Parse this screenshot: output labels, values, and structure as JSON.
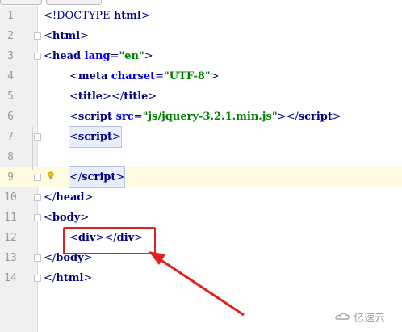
{
  "editor": {
    "lines": [
      {
        "n": "1",
        "tokens": [
          [
            "t",
            "<!DOCTYPE "
          ],
          [
            "b",
            "html"
          ],
          [
            "t",
            ">"
          ]
        ]
      },
      {
        "n": "2",
        "tokens": [
          [
            "t",
            "<"
          ],
          [
            "b",
            "html"
          ],
          [
            "t",
            ">"
          ]
        ]
      },
      {
        "n": "3",
        "tokens": [
          [
            "t",
            "<"
          ],
          [
            "b",
            "head "
          ],
          [
            "attr",
            "lang"
          ],
          [
            "t",
            "="
          ],
          [
            "val",
            "\"en\""
          ],
          [
            "t",
            ">"
          ]
        ]
      },
      {
        "n": "4",
        "tokens": [
          [
            "t",
            "<"
          ],
          [
            "b",
            "meta "
          ],
          [
            "attr",
            "charset"
          ],
          [
            "t",
            "="
          ],
          [
            "val",
            "\"UTF-8\""
          ],
          [
            "t",
            ">"
          ]
        ]
      },
      {
        "n": "5",
        "tokens": [
          [
            "t",
            "<"
          ],
          [
            "b",
            "title"
          ],
          [
            "t",
            "></"
          ],
          [
            "b",
            "title"
          ],
          [
            "t",
            ">"
          ]
        ]
      },
      {
        "n": "6",
        "tokens": [
          [
            "t",
            "<"
          ],
          [
            "b",
            "script "
          ],
          [
            "attr",
            "src"
          ],
          [
            "t",
            "="
          ],
          [
            "val",
            "\"js/jquery-3.2.1.min.js\""
          ],
          [
            "t",
            "></"
          ],
          [
            "b",
            "script"
          ],
          [
            "t",
            ">"
          ]
        ]
      },
      {
        "n": "7",
        "tokens": [
          [
            "t",
            "<"
          ],
          [
            "b",
            "script"
          ],
          [
            "t",
            ">"
          ]
        ]
      },
      {
        "n": "8",
        "tokens": []
      },
      {
        "n": "9",
        "tokens": [
          [
            "t",
            "</"
          ],
          [
            "b",
            "script"
          ],
          [
            "t",
            ">"
          ]
        ]
      },
      {
        "n": "10",
        "tokens": [
          [
            "t",
            "</"
          ],
          [
            "b",
            "head"
          ],
          [
            "t",
            ">"
          ]
        ]
      },
      {
        "n": "11",
        "tokens": [
          [
            "t",
            "<"
          ],
          [
            "b",
            "body"
          ],
          [
            "t",
            ">"
          ]
        ]
      },
      {
        "n": "12",
        "tokens": [
          [
            "t",
            "<"
          ],
          [
            "b",
            "div"
          ],
          [
            "t",
            "></"
          ],
          [
            "b",
            "div"
          ],
          [
            "t",
            ">"
          ]
        ]
      },
      {
        "n": "13",
        "tokens": [
          [
            "t",
            "</"
          ],
          [
            "b",
            "body"
          ],
          [
            "t",
            ">"
          ]
        ]
      },
      {
        "n": "14",
        "tokens": [
          [
            "t",
            "</"
          ],
          [
            "b",
            "html"
          ],
          [
            "t",
            ">"
          ]
        ]
      }
    ]
  },
  "watermark": {
    "text": "亿速云"
  },
  "colors": {
    "highlight_line": "#fffbe0",
    "annotation": "#e02020"
  }
}
